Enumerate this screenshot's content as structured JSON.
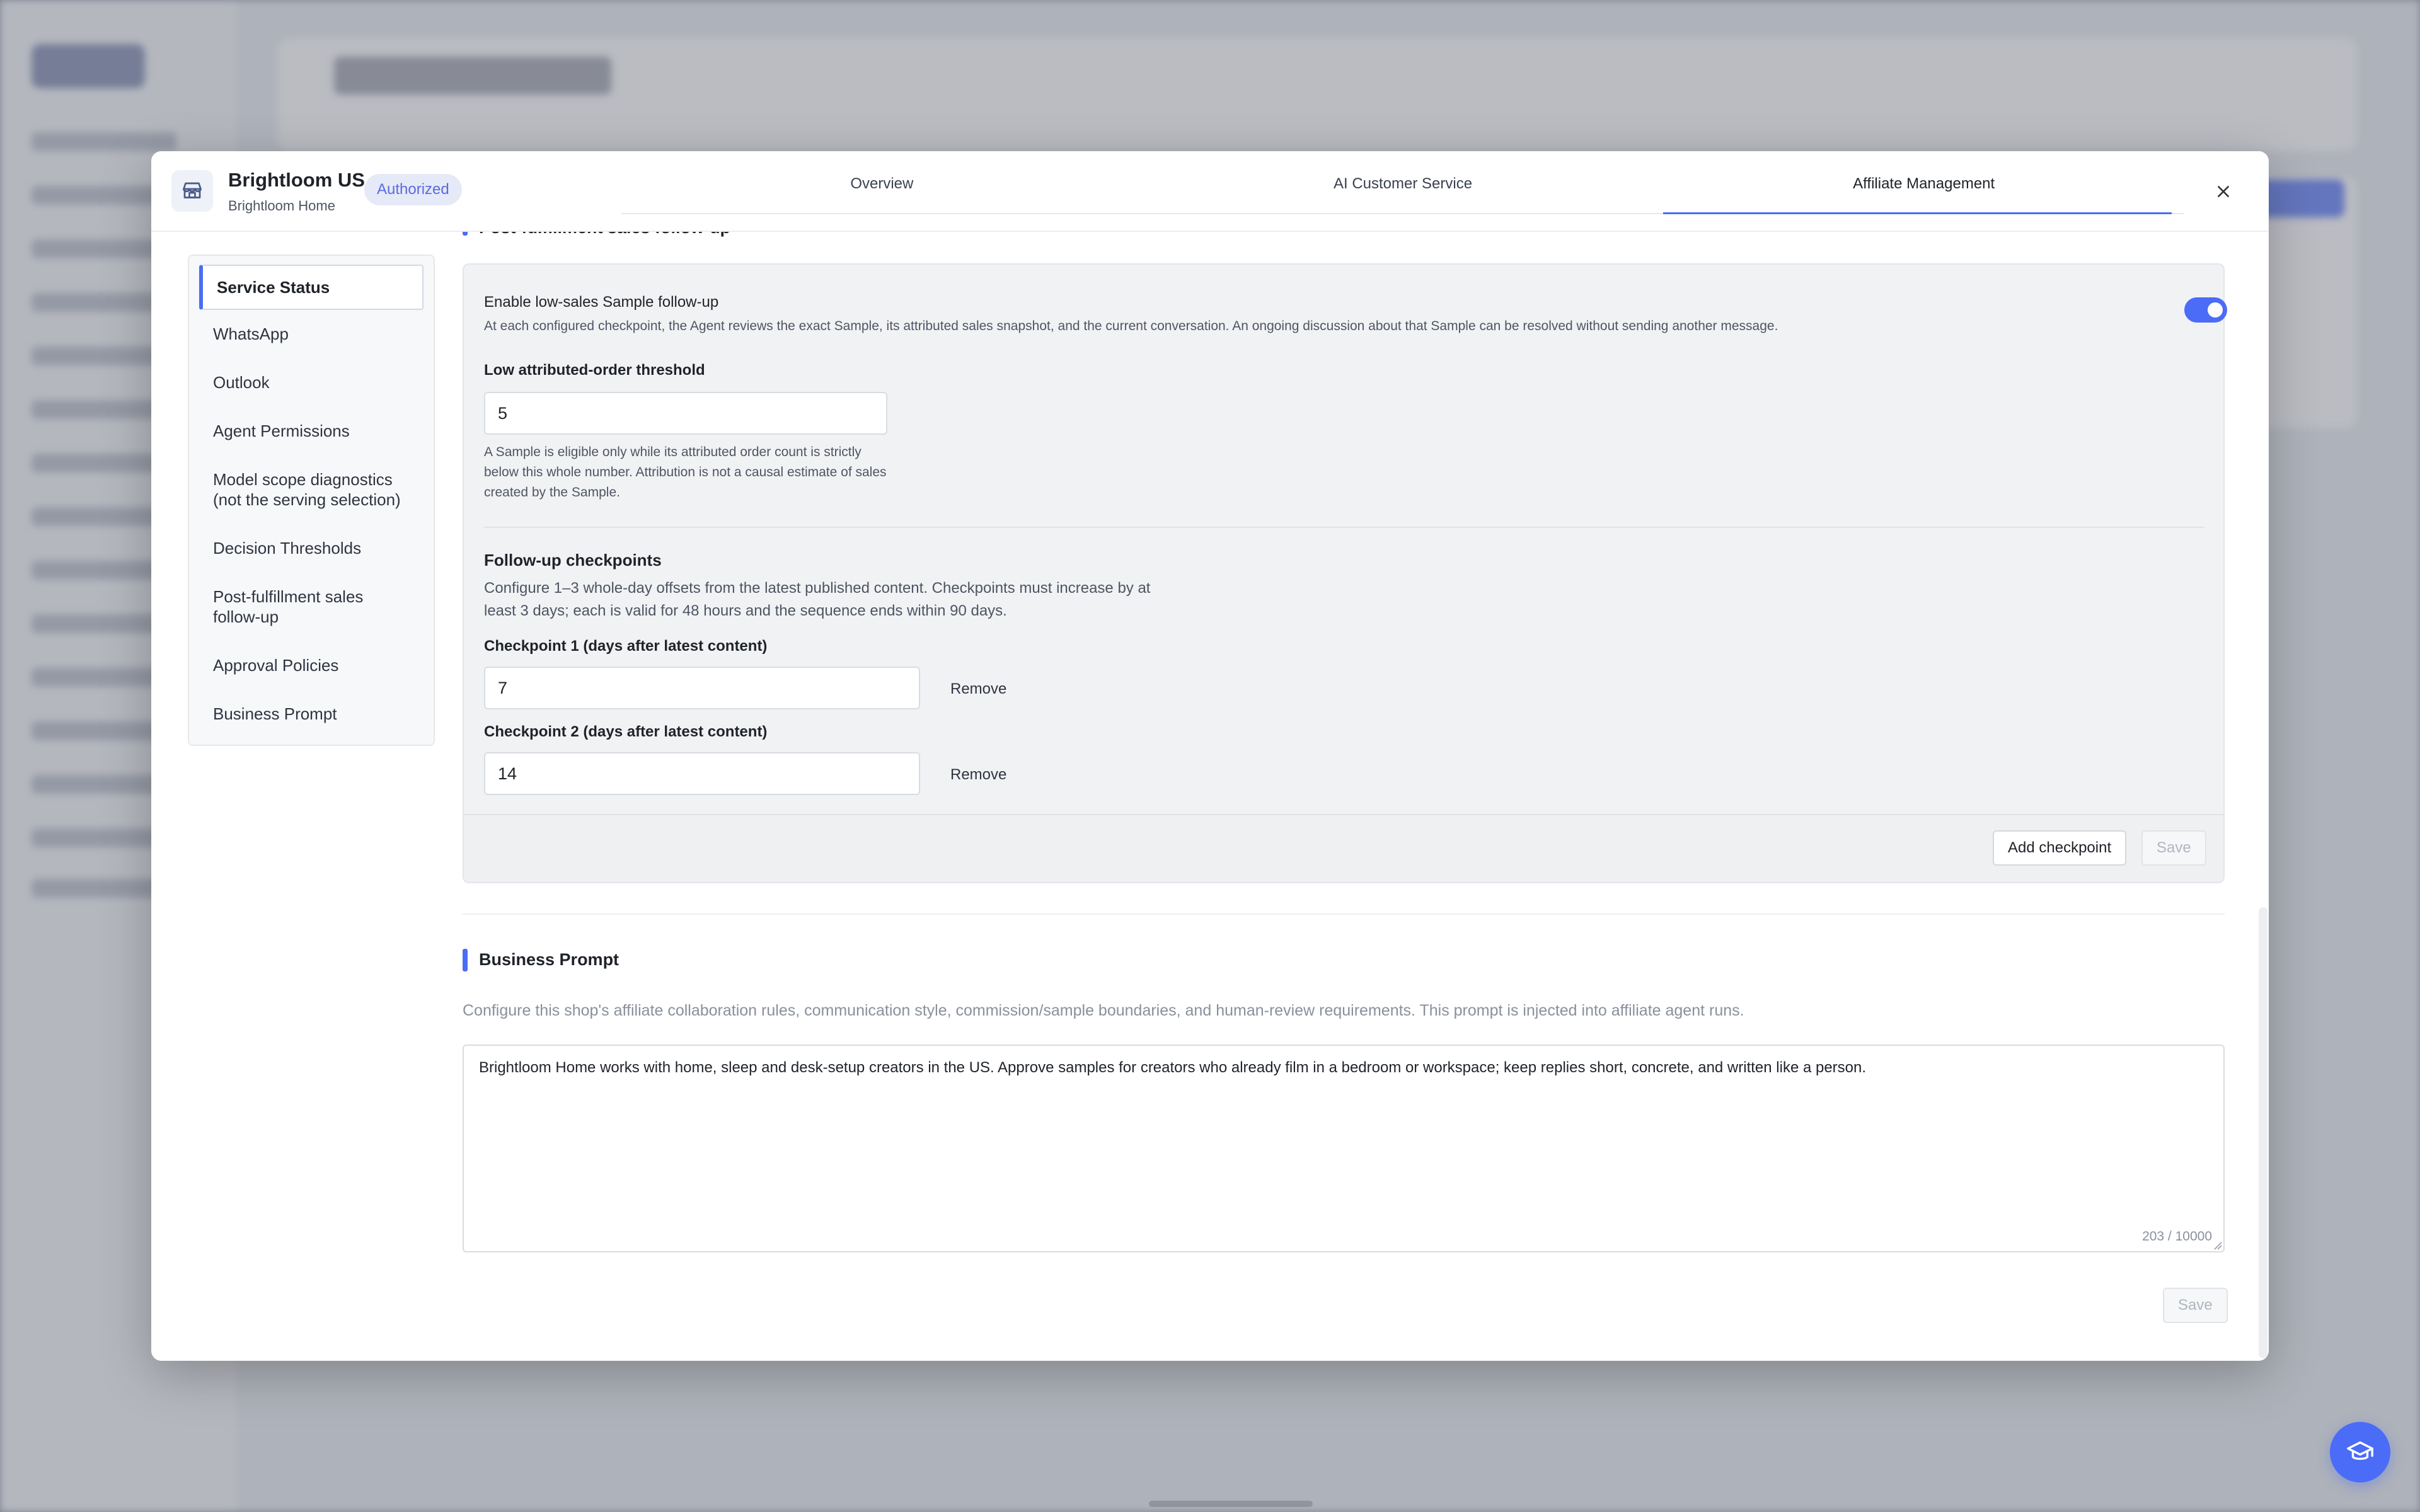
{
  "colors": {
    "accent": "#4a6cf7",
    "badge_bg": "#e6e9f7",
    "badge_text": "#5a6be0",
    "card_bg": "#f1f2f4"
  },
  "modal": {
    "shop_icon": "store-icon",
    "shop_name": "Brightloom US",
    "shop_subtitle": "Brightloom Home",
    "status_badge": "Authorized",
    "tabs": [
      {
        "label": "Overview",
        "active": false
      },
      {
        "label": "AI Customer Service",
        "active": false
      },
      {
        "label": "Affiliate Management",
        "active": true
      }
    ],
    "close_icon": "close-icon"
  },
  "sidebar": {
    "items": [
      {
        "label": "Service Status",
        "active": true
      },
      {
        "label": "WhatsApp"
      },
      {
        "label": "Outlook"
      },
      {
        "label": "Agent Permissions"
      },
      {
        "label": "Model scope diagnostics (not the serving selection)"
      },
      {
        "label": "Decision Thresholds"
      },
      {
        "label": "Post-fulfillment sales follow-up"
      },
      {
        "label": "Approval Policies"
      },
      {
        "label": "Business Prompt"
      }
    ]
  },
  "followup": {
    "section_title": "Post-fulfillment sales follow-up",
    "enable_label": "Enable low-sales Sample follow-up",
    "enable_help": "At each configured checkpoint, the Agent reviews the exact Sample, its attributed sales snapshot, and the current conversation. An ongoing discussion about that Sample can be resolved without sending another message.",
    "enabled": true,
    "threshold_label": "Low attributed-order threshold",
    "threshold_value": "5",
    "threshold_help": "A Sample is eligible only while its attributed order count is strictly below this whole number. Attribution is not a causal estimate of sales created by the Sample.",
    "checkpoints_title": "Follow-up checkpoints",
    "checkpoints_help": "Configure 1–3 whole-day offsets from the latest published content. Checkpoints must increase by at least 3 days; each is valid for 48 hours and the sequence ends within 90 days.",
    "checkpoints": [
      {
        "label": "Checkpoint 1 (days after latest content)",
        "value": "7",
        "remove_label": "Remove"
      },
      {
        "label": "Checkpoint 2 (days after latest content)",
        "value": "14",
        "remove_label": "Remove"
      }
    ],
    "add_checkpoint_label": "Add checkpoint",
    "save_label": "Save"
  },
  "business_prompt": {
    "title": "Business Prompt",
    "description": "Configure this shop's affiliate collaboration rules, communication style, commission/sample boundaries, and human-review requirements. This prompt is injected into affiliate agent runs.",
    "value": "Brightloom Home works with home, sleep and desk-setup creators in the US. Approve samples for creators who already film in a bedroom or workspace; keep replies short, concrete, and written like a person.",
    "counter": "203 / 10000",
    "save_label": "Save"
  },
  "fab_icon": "graduation-cap-icon"
}
